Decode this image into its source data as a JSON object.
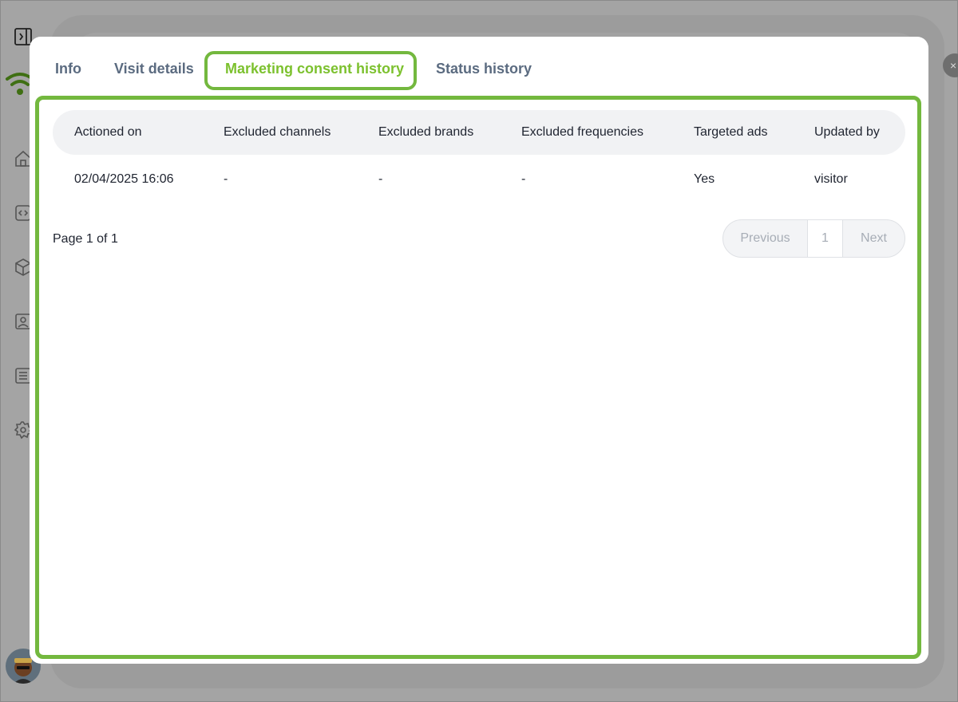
{
  "tabs": [
    {
      "label": "Info"
    },
    {
      "label": "Visit details"
    },
    {
      "label": "Marketing consent history"
    },
    {
      "label": "Status history"
    }
  ],
  "active_tab": "Marketing consent history",
  "table": {
    "columns": [
      "Actioned on",
      "Excluded channels",
      "Excluded brands",
      "Excluded frequencies",
      "Targeted ads",
      "Updated by"
    ],
    "rows": [
      [
        "02/04/2025 16:06",
        "-",
        "-",
        "-",
        "Yes",
        "visitor"
      ]
    ]
  },
  "pagination": {
    "info": "Page 1 of 1",
    "previous_label": "Previous",
    "current_page": "1",
    "next_label": "Next"
  },
  "colors": {
    "accent": "#7cc12e",
    "highlight_border": "#73b83e",
    "tab_inactive": "#5b6b80"
  }
}
